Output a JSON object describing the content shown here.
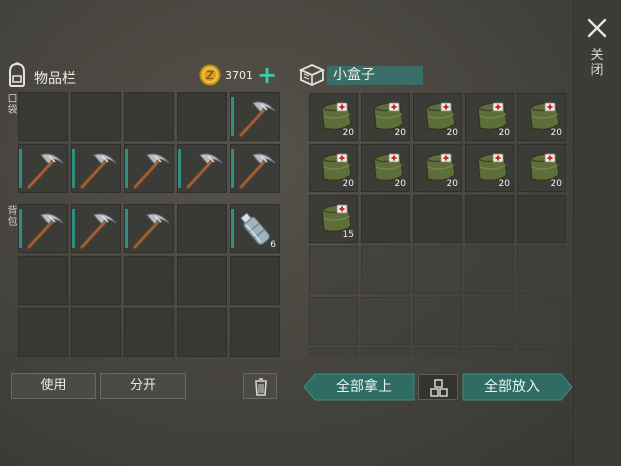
{
  "window": {
    "close_label": "关闭"
  },
  "inventory": {
    "title": "物品栏",
    "coins": "3701",
    "pocket_label": "口袋",
    "backpack_label": "背包",
    "pocket_slots": [
      {
        "item": "",
        "qty": ""
      },
      {
        "item": "",
        "qty": ""
      },
      {
        "item": "",
        "qty": ""
      },
      {
        "item": "",
        "qty": ""
      },
      {
        "item": "pickaxe",
        "qty": ""
      },
      {
        "item": "pickaxe",
        "qty": ""
      },
      {
        "item": "pickaxe",
        "qty": ""
      },
      {
        "item": "pickaxe",
        "qty": ""
      },
      {
        "item": "pickaxe",
        "qty": ""
      },
      {
        "item": "pickaxe",
        "qty": ""
      }
    ],
    "backpack_slots": [
      {
        "item": "pickaxe",
        "qty": ""
      },
      {
        "item": "pickaxe",
        "qty": ""
      },
      {
        "item": "pickaxe",
        "qty": ""
      },
      {
        "item": "",
        "qty": ""
      },
      {
        "item": "water-bottle",
        "qty": "6"
      },
      {
        "item": "",
        "qty": ""
      },
      {
        "item": "",
        "qty": ""
      },
      {
        "item": "",
        "qty": ""
      },
      {
        "item": "",
        "qty": ""
      },
      {
        "item": "",
        "qty": ""
      },
      {
        "item": "",
        "qty": ""
      },
      {
        "item": "",
        "qty": ""
      },
      {
        "item": "",
        "qty": ""
      },
      {
        "item": "",
        "qty": ""
      },
      {
        "item": "",
        "qty": ""
      }
    ],
    "use_label": "使用",
    "split_label": "分开"
  },
  "container": {
    "title": "小盒子",
    "slots": [
      {
        "item": "medkit-bag",
        "qty": "20"
      },
      {
        "item": "medkit-bag",
        "qty": "20"
      },
      {
        "item": "medkit-bag",
        "qty": "20"
      },
      {
        "item": "medkit-bag",
        "qty": "20"
      },
      {
        "item": "medkit-bag",
        "qty": "20"
      },
      {
        "item": "medkit-bag",
        "qty": "20"
      },
      {
        "item": "medkit-bag",
        "qty": "20"
      },
      {
        "item": "medkit-bag",
        "qty": "20"
      },
      {
        "item": "medkit-bag",
        "qty": "20"
      },
      {
        "item": "medkit-bag",
        "qty": "20"
      },
      {
        "item": "medkit-bag",
        "qty": "15"
      },
      {
        "item": "",
        "qty": ""
      },
      {
        "item": "",
        "qty": ""
      },
      {
        "item": "",
        "qty": ""
      },
      {
        "item": "",
        "qty": ""
      }
    ],
    "take_all_label": "全部拿上",
    "put_all_label": "全部放入"
  },
  "colors": {
    "accent": "#2f8f80",
    "teal_button": "#2f6d62",
    "coin": "#d9a320"
  }
}
